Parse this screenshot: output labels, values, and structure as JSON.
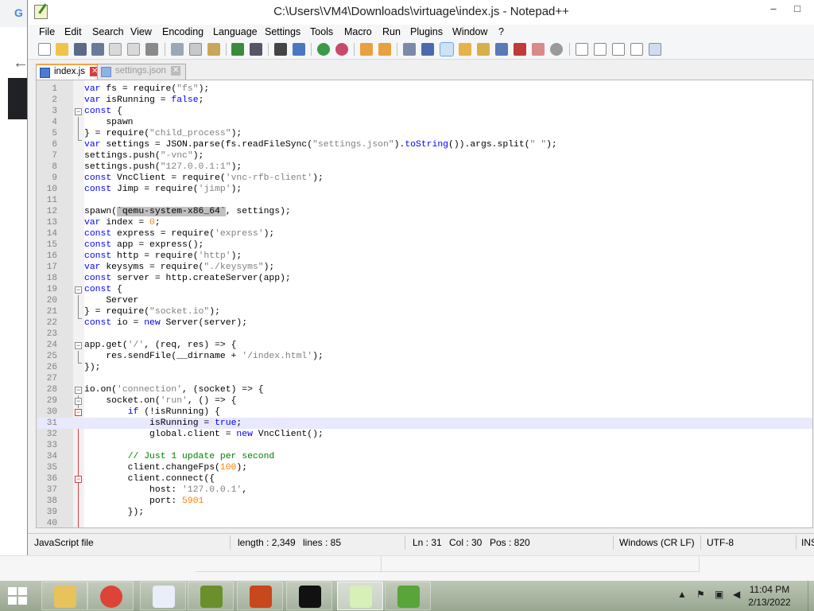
{
  "window": {
    "title": "C:\\Users\\VM4\\Downloads\\virtuage\\index.js - Notepad++",
    "minimize_glyph": "‒",
    "maximize_glyph": "□",
    "close_glyph": "✕"
  },
  "menu": [
    "File",
    "Edit",
    "Search",
    "View",
    "Encoding",
    "Language",
    "Settings",
    "Tools",
    "Macro",
    "Run",
    "Plugins",
    "Window",
    "?"
  ],
  "tabs": [
    {
      "label": "index.js",
      "active": true
    },
    {
      "label": "settings.json",
      "active": false
    }
  ],
  "tab_close_glyph": "✕",
  "editor": {
    "current_line": 31,
    "lines": [
      {
        "n": "1",
        "t": [
          [
            "k",
            "var "
          ],
          [
            "",
            "fs = require("
          ],
          [
            "s",
            "\"fs\""
          ],
          [
            "",
            ");"
          ]
        ]
      },
      {
        "n": "2",
        "t": [
          [
            "k",
            "var "
          ],
          [
            "",
            "isRunning = "
          ],
          [
            "k",
            "false"
          ],
          [
            "",
            ";"
          ]
        ]
      },
      {
        "n": "3",
        "t": [
          [
            "k",
            "const "
          ],
          [
            "",
            "{"
          ]
        ]
      },
      {
        "n": "4",
        "t": [
          [
            "",
            "    spawn"
          ]
        ]
      },
      {
        "n": "5",
        "t": [
          [
            "",
            "} = require("
          ],
          [
            "s",
            "\"child_process\""
          ],
          [
            "",
            ");"
          ]
        ]
      },
      {
        "n": "6",
        "t": [
          [
            "k",
            "var "
          ],
          [
            "",
            "settings = JSON.parse(fs.readFileSync("
          ],
          [
            "s",
            "\"settings.json\""
          ],
          [
            "",
            ")."
          ],
          [
            "k",
            "toString"
          ],
          [
            "",
            "()).args.split("
          ],
          [
            "s",
            "\" \""
          ],
          [
            "",
            ");"
          ]
        ]
      },
      {
        "n": "7",
        "t": [
          [
            "",
            "settings.push("
          ],
          [
            "s",
            "\"-vnc\""
          ],
          [
            "",
            ");"
          ]
        ]
      },
      {
        "n": "8",
        "t": [
          [
            "",
            "settings.push("
          ],
          [
            "s",
            "\"127.0.0.1:1\""
          ],
          [
            "",
            ");"
          ]
        ]
      },
      {
        "n": "9",
        "t": [
          [
            "k",
            "const "
          ],
          [
            "",
            "VncClient = require("
          ],
          [
            "s",
            "'vnc-rfb-client'"
          ],
          [
            "",
            ");"
          ]
        ]
      },
      {
        "n": "10",
        "t": [
          [
            "k",
            "const "
          ],
          [
            "",
            "Jimp = require("
          ],
          [
            "s",
            "'jimp'"
          ],
          [
            "",
            ");"
          ]
        ]
      },
      {
        "n": "11",
        "t": [
          [
            "",
            ""
          ]
        ]
      },
      {
        "n": "12",
        "t": [
          [
            "",
            "spawn("
          ],
          [
            "sel",
            "`qemu-system-x86_64`"
          ],
          [
            "",
            ", settings);"
          ]
        ]
      },
      {
        "n": "13",
        "t": [
          [
            "k",
            "var "
          ],
          [
            "",
            "index = "
          ],
          [
            "n",
            "0"
          ],
          [
            "",
            ";"
          ]
        ]
      },
      {
        "n": "14",
        "t": [
          [
            "k",
            "const "
          ],
          [
            "",
            "express = require("
          ],
          [
            "s",
            "'express'"
          ],
          [
            "",
            ");"
          ]
        ]
      },
      {
        "n": "15",
        "t": [
          [
            "k",
            "const "
          ],
          [
            "",
            "app = express();"
          ]
        ]
      },
      {
        "n": "16",
        "t": [
          [
            "k",
            "const "
          ],
          [
            "",
            "http = require("
          ],
          [
            "s",
            "'http'"
          ],
          [
            "",
            ");"
          ]
        ]
      },
      {
        "n": "17",
        "t": [
          [
            "k",
            "var "
          ],
          [
            "",
            "keysyms = require("
          ],
          [
            "s",
            "\"./keysyms\""
          ],
          [
            "",
            ");"
          ]
        ]
      },
      {
        "n": "18",
        "t": [
          [
            "k",
            "const "
          ],
          [
            "",
            "server = http.createServer(app);"
          ]
        ]
      },
      {
        "n": "19",
        "t": [
          [
            "k",
            "const "
          ],
          [
            "",
            "{"
          ]
        ]
      },
      {
        "n": "20",
        "t": [
          [
            "",
            "    Server"
          ]
        ]
      },
      {
        "n": "21",
        "t": [
          [
            "",
            "} = require("
          ],
          [
            "s",
            "\"socket.io\""
          ],
          [
            "",
            ");"
          ]
        ]
      },
      {
        "n": "22",
        "t": [
          [
            "k",
            "const "
          ],
          [
            "",
            "io = "
          ],
          [
            "k",
            "new "
          ],
          [
            "",
            "Server(server);"
          ]
        ]
      },
      {
        "n": "23",
        "t": [
          [
            "",
            ""
          ]
        ]
      },
      {
        "n": "24",
        "t": [
          [
            "",
            "app.get("
          ],
          [
            "s",
            "'/'"
          ],
          [
            "",
            ", (req, res) => {"
          ]
        ]
      },
      {
        "n": "25",
        "t": [
          [
            "",
            "    res.sendFile(__dirname + "
          ],
          [
            "s",
            "'/index.html'"
          ],
          [
            "",
            ");"
          ]
        ]
      },
      {
        "n": "26",
        "t": [
          [
            "",
            "});"
          ]
        ]
      },
      {
        "n": "27",
        "t": [
          [
            "",
            ""
          ]
        ]
      },
      {
        "n": "28",
        "t": [
          [
            "",
            "io.on("
          ],
          [
            "s",
            "'connection'"
          ],
          [
            "",
            ", (socket) => {"
          ]
        ]
      },
      {
        "n": "29",
        "t": [
          [
            "",
            "    socket.on("
          ],
          [
            "s",
            "'run'"
          ],
          [
            "",
            ", () => {"
          ]
        ]
      },
      {
        "n": "30",
        "t": [
          [
            "",
            "        "
          ],
          [
            "k",
            "if "
          ],
          [
            "",
            "(!isRunning) {"
          ]
        ]
      },
      {
        "n": "31",
        "t": [
          [
            "",
            "            isRunning = "
          ],
          [
            "k",
            "true"
          ],
          [
            "",
            ";"
          ]
        ]
      },
      {
        "n": "32",
        "t": [
          [
            "",
            "            global.client = "
          ],
          [
            "k",
            "new "
          ],
          [
            "",
            "VncClient();"
          ]
        ]
      },
      {
        "n": "33",
        "t": [
          [
            "",
            ""
          ]
        ]
      },
      {
        "n": "34",
        "t": [
          [
            "",
            "        "
          ],
          [
            "c",
            "// Just 1 update per second"
          ]
        ]
      },
      {
        "n": "35",
        "t": [
          [
            "",
            "        client.changeFps("
          ],
          [
            "n",
            "100"
          ],
          [
            "",
            ");"
          ]
        ]
      },
      {
        "n": "36",
        "t": [
          [
            "",
            "        client.connect({"
          ]
        ]
      },
      {
        "n": "37",
        "t": [
          [
            "",
            "            host: "
          ],
          [
            "s",
            "'127.0.0.1'"
          ],
          [
            "",
            ","
          ]
        ]
      },
      {
        "n": "38",
        "t": [
          [
            "",
            "            port: "
          ],
          [
            "n",
            "5901"
          ]
        ]
      },
      {
        "n": "39",
        "t": [
          [
            "",
            "        });"
          ]
        ]
      },
      {
        "n": "40",
        "t": [
          [
            "",
            ""
          ]
        ]
      }
    ]
  },
  "status": {
    "file_type": "JavaScript file",
    "length": "length : 2,349",
    "lines": "lines : 85",
    "ln": "Ln : 31",
    "col": "Col : 30",
    "pos": "Pos : 820",
    "eol": "Windows (CR LF)",
    "encoding": "UTF-8",
    "mode": "INS"
  },
  "taskbar": {
    "apps": [
      {
        "name": "file-explorer",
        "color": "#e8c25a"
      },
      {
        "name": "chrome",
        "color": "#db4437"
      },
      {
        "name": "app-blue-bird",
        "color": "#e9eef8"
      },
      {
        "name": "app-green-globe",
        "color": "#6b8f2a"
      },
      {
        "name": "app-red-orb",
        "color": "#c8471c"
      },
      {
        "name": "command-prompt",
        "color": "#111111"
      },
      {
        "name": "notepad-plus-plus",
        "color": "#d6f0b8"
      },
      {
        "name": "app-green-frog",
        "color": "#59a53a"
      }
    ],
    "tray_arrow": "▲",
    "time": "11:04 PM",
    "date": "2/13/2022"
  }
}
